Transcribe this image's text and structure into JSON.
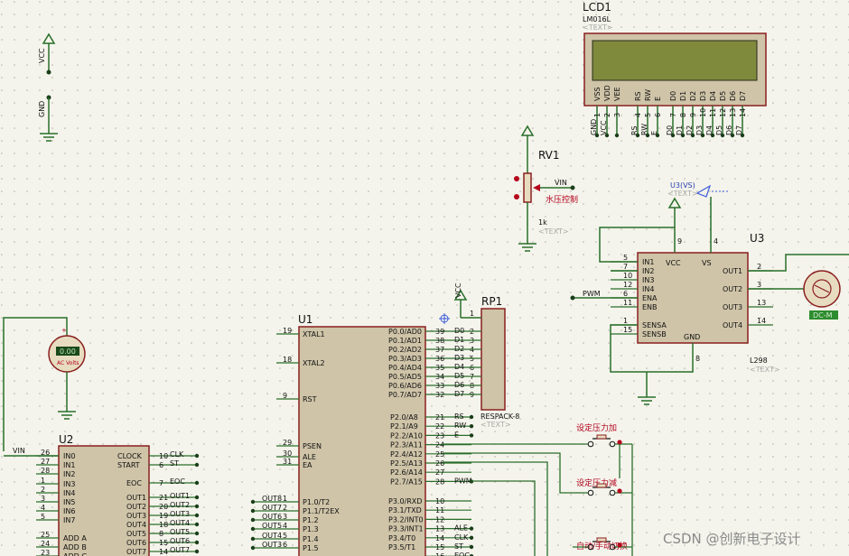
{
  "watermark": "CSDN @创新电子设计",
  "text_placeholder": "<TEXT>",
  "power": {
    "vcc_label": "VCC",
    "gnd_label": "GND"
  },
  "lcd": {
    "ref": "LCD1",
    "part": "LM016L",
    "screen_color": "#7f8a3d",
    "pins_top": [
      "VSS",
      "VDD",
      "VEE",
      "RS",
      "RW",
      "E",
      "D0",
      "D1",
      "D2",
      "D3",
      "D4",
      "D5",
      "D6",
      "D7"
    ],
    "pins_num": [
      "1",
      "2",
      "3",
      "4",
      "5",
      "6",
      "7",
      "8",
      "9",
      "10",
      "11",
      "12",
      "13",
      "14"
    ],
    "nets": [
      "GND",
      "VCC",
      "",
      "RS",
      "RW",
      "E",
      "D0",
      "D1",
      "D2",
      "D3",
      "D4",
      "D5",
      "D6",
      "D7"
    ]
  },
  "rv1": {
    "ref": "RV1",
    "value": "1k",
    "net": "VIN",
    "label": "水压控制"
  },
  "u3": {
    "ref": "U3",
    "part": "L298",
    "vs_net": "U3(VS)",
    "left_pins": [
      {
        "num": "5",
        "name": "IN1"
      },
      {
        "num": "7",
        "name": "IN2"
      },
      {
        "num": "10",
        "name": "IN3"
      },
      {
        "num": "12",
        "name": "IN4"
      },
      {
        "num": "6",
        "name": "ENA"
      },
      {
        "num": "11",
        "name": "ENB"
      },
      {
        "num": "1",
        "name": "SENSA"
      },
      {
        "num": "15",
        "name": "SENSB"
      }
    ],
    "top_pins": [
      {
        "num": "9",
        "name": "VCC"
      },
      {
        "num": "4",
        "name": "VS"
      }
    ],
    "right_pins": [
      {
        "num": "2",
        "name": "OUT1"
      },
      {
        "num": "3",
        "name": "OUT2"
      },
      {
        "num": "13",
        "name": "OUT3"
      },
      {
        "num": "14",
        "name": "OUT4"
      }
    ],
    "bottom_pin": {
      "num": "8",
      "name": "GND"
    },
    "pwm_net": "PWM"
  },
  "motor": {
    "display": "DC-M",
    "color": "#2d8c2d"
  },
  "rp1": {
    "ref": "RP1",
    "part": "RESPACK-8",
    "pins": [
      "1",
      "2",
      "3",
      "4",
      "5",
      "6",
      "7",
      "8",
      "9"
    ],
    "vcc": "VCC"
  },
  "voltmeter": {
    "label": "AC Volts",
    "reading": "0.00"
  },
  "u1": {
    "ref": "U1",
    "left_pins": [
      {
        "num": "19",
        "name": "XTAL1"
      },
      {
        "num": "18",
        "name": "XTAL2"
      },
      {
        "num": "9",
        "name": "RST"
      },
      {
        "num": "29",
        "name": "PSEN"
      },
      {
        "num": "30",
        "name": "ALE"
      },
      {
        "num": "31",
        "name": "EA"
      },
      {
        "num": "1",
        "name": "P1.0/T2"
      },
      {
        "num": "2",
        "name": "P1.1/T2EX"
      },
      {
        "num": "3",
        "name": "P1.2"
      },
      {
        "num": "4",
        "name": "P1.3"
      },
      {
        "num": "5",
        "name": "P1.4"
      },
      {
        "num": "6",
        "name": "P1.5"
      }
    ],
    "left_nets": [
      "OUT8",
      "OUT7",
      "OUT6",
      "OUT5",
      "OUT4",
      "OUT3"
    ],
    "right_p0": [
      {
        "num": "39",
        "name": "P0.0/AD0",
        "net": "D0"
      },
      {
        "num": "38",
        "name": "P0.1/AD1",
        "net": "D1"
      },
      {
        "num": "37",
        "name": "P0.2/AD2",
        "net": "D2"
      },
      {
        "num": "36",
        "name": "P0.3/AD3",
        "net": "D3"
      },
      {
        "num": "35",
        "name": "P0.4/AD4",
        "net": "D4"
      },
      {
        "num": "34",
        "name": "P0.5/AD5",
        "net": "D5"
      },
      {
        "num": "33",
        "name": "P0.6/AD6",
        "net": "D6"
      },
      {
        "num": "32",
        "name": "P0.7/AD7",
        "net": "D7"
      }
    ],
    "right_p2": [
      {
        "num": "21",
        "name": "P2.0/A8",
        "net": "RS"
      },
      {
        "num": "22",
        "name": "P2.1/A9",
        "net": "RW"
      },
      {
        "num": "23",
        "name": "P2.2/A10",
        "net": "E"
      },
      {
        "num": "24",
        "name": "P2.3/A11",
        "net": ""
      },
      {
        "num": "25",
        "name": "P2.4/A12",
        "net": ""
      },
      {
        "num": "26",
        "name": "P2.5/A13",
        "net": ""
      },
      {
        "num": "27",
        "name": "P2.6/A14",
        "net": ""
      },
      {
        "num": "28",
        "name": "P2.7/A15",
        "net": "PWM"
      }
    ],
    "right_p3": [
      {
        "num": "10",
        "name": "P3.0/RXD",
        "net": ""
      },
      {
        "num": "11",
        "name": "P3.1/TXD",
        "net": ""
      },
      {
        "num": "12",
        "name": "P3.2/INT0",
        "net": ""
      },
      {
        "num": "13",
        "name": "P3.3/INT1",
        "net": "ALE"
      },
      {
        "num": "14",
        "name": "P3.4/T0",
        "net": "CLK"
      },
      {
        "num": "15",
        "name": "P3.5/T1",
        "net": "ST"
      },
      {
        "num": "16",
        "name": "",
        "net": "EOC"
      }
    ]
  },
  "u2": {
    "ref": "U2",
    "vin_net": "VIN",
    "left_pins": [
      {
        "num": "26",
        "name": "IN0"
      },
      {
        "num": "27",
        "name": "IN1"
      },
      {
        "num": "28",
        "name": "IN2"
      },
      {
        "num": "1",
        "name": "IN3"
      },
      {
        "num": "2",
        "name": "IN4"
      },
      {
        "num": "3",
        "name": "IN5"
      },
      {
        "num": "4",
        "name": "IN6"
      },
      {
        "num": "5",
        "name": "IN7"
      },
      {
        "num": "25",
        "name": "ADD A"
      },
      {
        "num": "24",
        "name": "ADD B"
      },
      {
        "num": "23",
        "name": "ADD C"
      }
    ],
    "right_pins": [
      {
        "num": "10",
        "name": "CLOCK",
        "net": "CLK"
      },
      {
        "num": "6",
        "name": "START",
        "net": "ST"
      },
      {
        "num": "7",
        "name": "EOC",
        "net": "EOC"
      },
      {
        "num": "21",
        "name": "OUT1",
        "net": "OUT1"
      },
      {
        "num": "20",
        "name": "OUT2",
        "net": "OUT2"
      },
      {
        "num": "19",
        "name": "OUT3",
        "net": "OUT3"
      },
      {
        "num": "18",
        "name": "OUT4",
        "net": "OUT4"
      },
      {
        "num": "8",
        "name": "OUT5",
        "net": "OUT5"
      },
      {
        "num": "15",
        "name": "OUT6",
        "net": "OUT6"
      },
      {
        "num": "14",
        "name": "OUT7",
        "net": "OUT7"
      }
    ]
  },
  "buttons": [
    {
      "label": "设定压力加"
    },
    {
      "label": "设定压力减"
    },
    {
      "label": "自动/手动切换"
    }
  ]
}
